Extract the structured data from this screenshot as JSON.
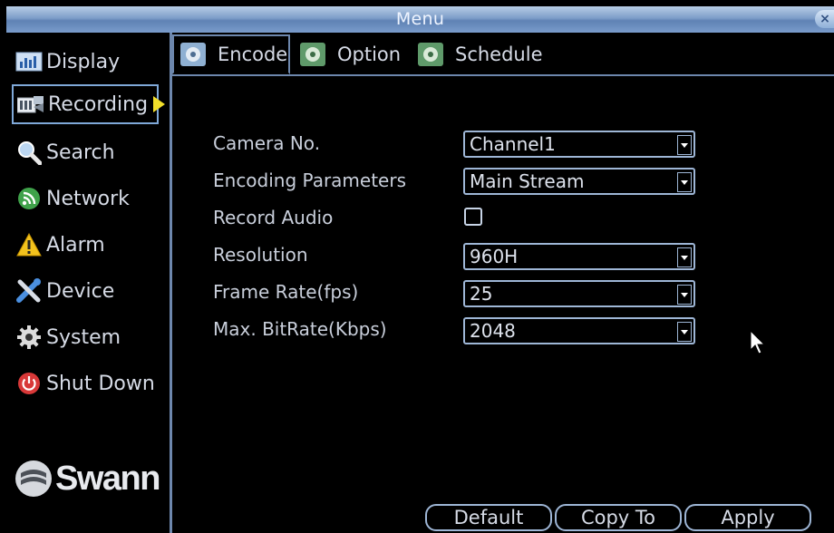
{
  "window": {
    "title": "Menu",
    "close_label": "×"
  },
  "sidebar": {
    "items": [
      {
        "label": "Display",
        "icon": "display-icon"
      },
      {
        "label": "Recording",
        "icon": "recording-icon",
        "active": true
      },
      {
        "label": "Search",
        "icon": "search-icon"
      },
      {
        "label": "Network",
        "icon": "network-icon"
      },
      {
        "label": "Alarm",
        "icon": "alarm-icon"
      },
      {
        "label": "Device",
        "icon": "device-icon"
      },
      {
        "label": "System",
        "icon": "system-icon"
      },
      {
        "label": "Shut Down",
        "icon": "power-icon"
      }
    ],
    "logo_text": "Swann"
  },
  "tabs": [
    {
      "label": "Encode",
      "active": true
    },
    {
      "label": "Option"
    },
    {
      "label": "Schedule"
    }
  ],
  "form": {
    "camera_no": {
      "label": "Camera No.",
      "value": "Channel1"
    },
    "encoding_parameters": {
      "label": "Encoding Parameters",
      "value": "Main Stream"
    },
    "record_audio": {
      "label": "Record Audio",
      "checked": false
    },
    "resolution": {
      "label": "Resolution",
      "value": "960H"
    },
    "frame_rate": {
      "label": "Frame Rate(fps)",
      "value": "25"
    },
    "max_bitrate": {
      "label": "Max. BitRate(Kbps)",
      "value": "2048"
    }
  },
  "buttons": {
    "default": "Default",
    "copy_to": "Copy To",
    "apply": "Apply"
  },
  "colors": {
    "accent": "#6d87ad",
    "title_bar": "#7d9dc8",
    "active_arrow": "#f2df2a"
  }
}
